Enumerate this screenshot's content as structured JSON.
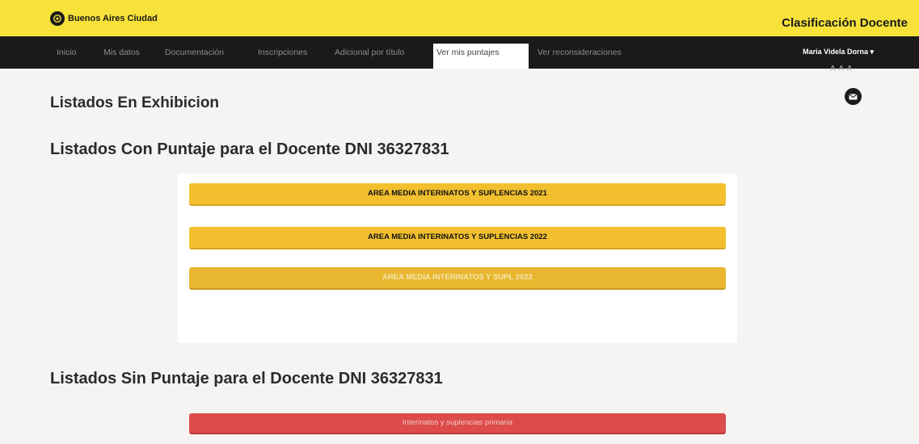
{
  "header": {
    "logo_text": "Buenos Aires Ciudad",
    "app_title": "Clasificación Docente"
  },
  "nav": {
    "items": [
      "Inicio",
      "Mis datos",
      "Documentación",
      "Inscripciones",
      "Adicional por título",
      "Ver mis puntajes",
      "Ver reconsideraciones"
    ],
    "active": "Ver mis puntajes",
    "user": "Maria Videla Dorna ▾"
  },
  "tools": {
    "font_size": "A A A",
    "mail_icon": "mail-icon"
  },
  "main": {
    "exhibicion_title": "Listados En Exhibicion",
    "con_puntaje_title": "Listados Con Puntaje para el Docente DNI 36327831",
    "con_puntaje_lists": [
      "AREA MEDIA INTERINATOS Y SUPLENCIAS 2021",
      "AREA MEDIA INTERINATOS Y SUPLENCIAS 2022",
      "AREA MEDIA INTERINATOS Y SUPL 2022"
    ],
    "sin_puntaje_title": "Listados Sin Puntaje para el Docente DNI 36327831",
    "sin_puntaje_lists": [
      "Interinatos y suplencias primaria"
    ]
  },
  "colors": {
    "brand_yellow": "#f7e23a",
    "nav_black": "#1a1a1a",
    "button_yellow": "#f2c02f",
    "button_red": "#dd4b4b"
  }
}
